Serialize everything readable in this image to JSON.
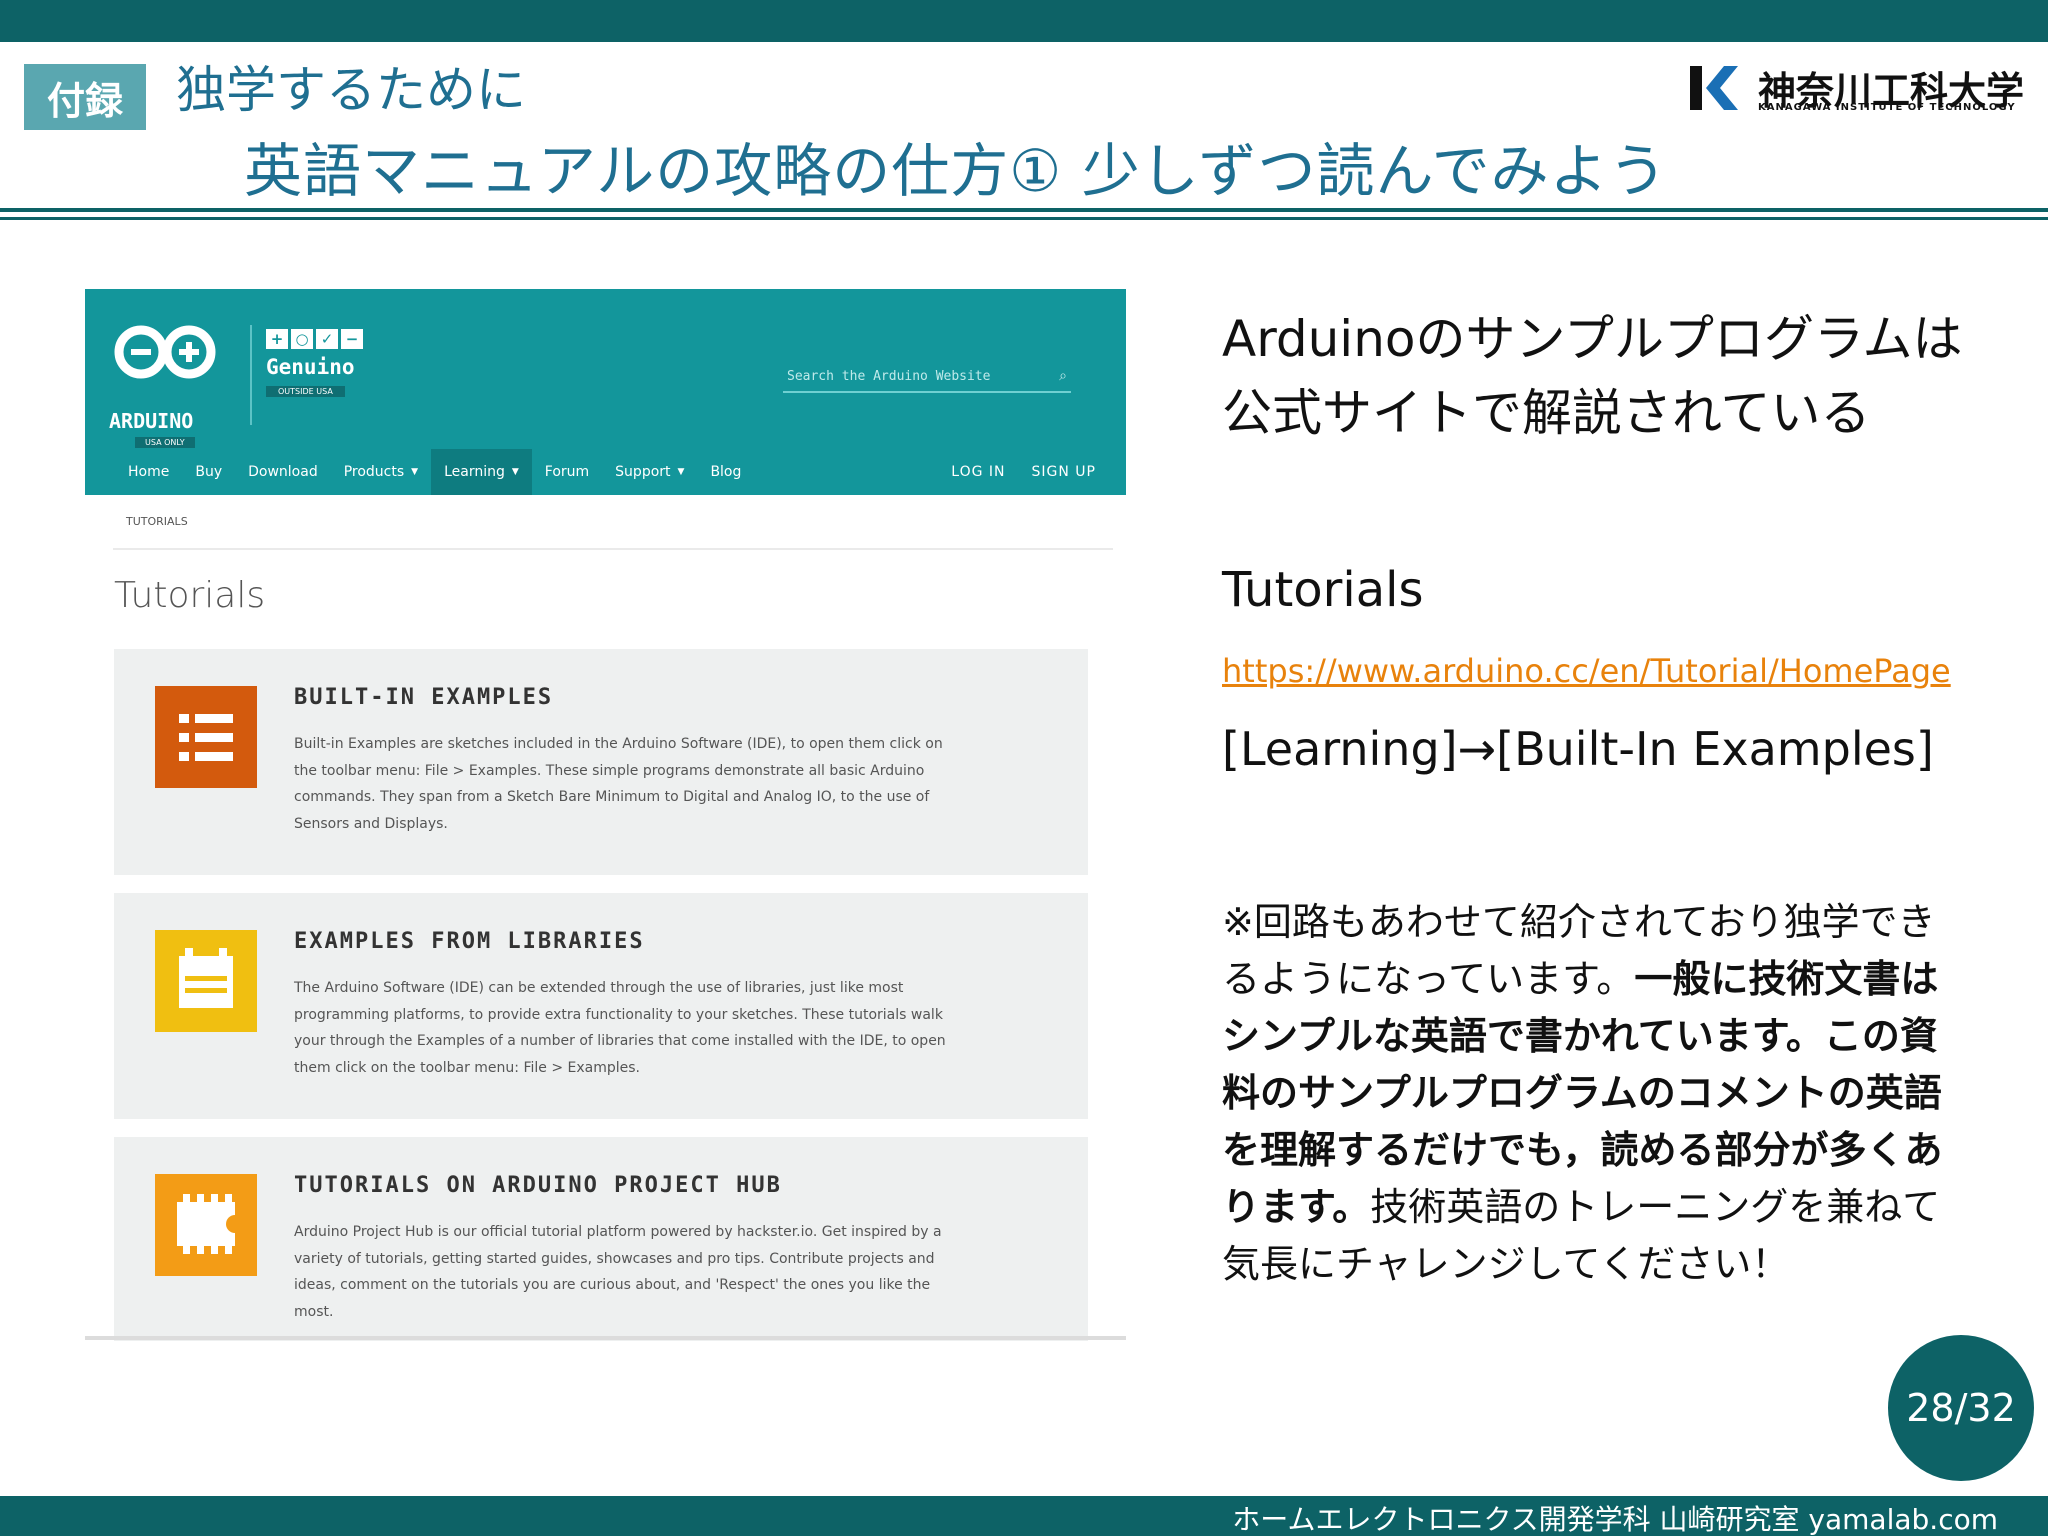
{
  "header": {
    "badge": "付録",
    "subtitle": "独学するために",
    "title": "英語マニュアルの攻略の仕方① 少しずつ読んでみよう",
    "logo_name": "神奈川工科大学",
    "logo_en": "KANAGAWA INSTITUTE OF TECHNOLOGY"
  },
  "site": {
    "arduino_logo": "ARDUINO",
    "arduino_usa": "USA ONLY",
    "genuino_logo": "Genuino",
    "genuino_sub": "OUTSIDE USA",
    "search_placeholder": "Search the Arduino Website",
    "nav": {
      "home": "Home",
      "buy": "Buy",
      "download": "Download",
      "products": "Products",
      "learning": "Learning",
      "forum": "Forum",
      "support": "Support",
      "blog": "Blog",
      "login": "LOG IN",
      "signup": "SIGN UP"
    },
    "breadcrumb": "TUTORIALS",
    "heading": "Tutorials",
    "cards": [
      {
        "icon": "list-icon",
        "color": "#d35a0d",
        "title": "BUILT-IN EXAMPLES",
        "desc": "Built-in Examples are sketches included in the Arduino Software (IDE), to open them click on the toolbar menu: File > Examples. These simple programs demonstrate all basic Arduino commands. They span from a Sketch Bare Minimum to Digital and Analog IO, to the use of Sensors and Displays."
      },
      {
        "icon": "calendar-icon",
        "color": "#f0bf11",
        "title": "EXAMPLES FROM LIBRARIES",
        "desc": "The Arduino Software (IDE) can be extended through the use of libraries, just like most programming platforms, to provide extra functionality to your sketches. These tutorials walk your through the Examples of a number of libraries that come installed with the IDE, to open them click on the toolbar menu: File > Examples."
      },
      {
        "icon": "puzzle-chip-icon",
        "color": "#f39c16",
        "title": "TUTORIALS ON ARDUINO PROJECT HUB",
        "desc": "Arduino Project Hub is our official tutorial platform powered by hackster.io. Get inspired by a variety of tutorials, getting started guides, showcases and pro tips. Contribute projects and ideas, comment on the tutorials you are curious about, and 'Respect' the ones you like the most."
      }
    ]
  },
  "right": {
    "intro_line1": "Arduinoのサンプルプログラムは",
    "intro_line2": "公式サイトで解説されている",
    "tut_title": "Tutorials",
    "tut_url": "https://www.arduino.cc/en/Tutorial/HomePage",
    "tut_path": "[Learning]→[Built-In Examples]",
    "note_part1": "※回路もあわせて紹介されており独学できるようになっています。",
    "note_bold": "一般に技術文書はシンプルな英語で書かれています。この資料のサンプルプログラムのコメントの英語を理解するだけでも，読める部分が多くあります。",
    "note_part2": "技術英語のトレーニングを兼ねて気長にチャレンジしてください！"
  },
  "page_number": "28/32",
  "footer": "ホームエレクトロニクス開発学科 山崎研究室 yamalab.com",
  "colors": {
    "slide_teal": "#0d6266",
    "site_teal": "#13969b",
    "title_blue": "#1f6f91",
    "link_orange": "#e8820c"
  }
}
